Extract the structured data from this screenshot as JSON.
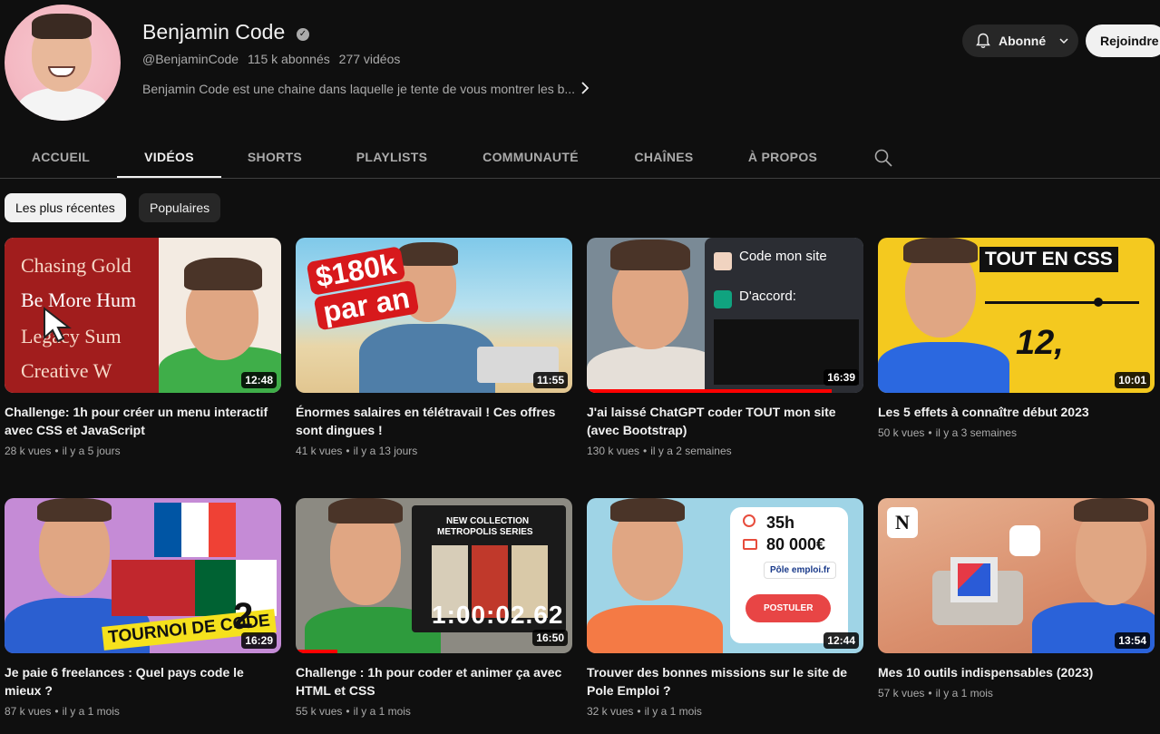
{
  "channel": {
    "name": "Benjamin Code",
    "handle": "@BenjaminCode",
    "subscribers": "115 k abonnés",
    "videos_count": "277 vidéos",
    "description": "Benjamin Code est une chaine dans laquelle je tente de vous montrer les b..."
  },
  "actions": {
    "subscribe_label": "Abonné",
    "join_label": "Rejoindre"
  },
  "tabs": [
    {
      "label": "ACCUEIL"
    },
    {
      "label": "VIDÉOS"
    },
    {
      "label": "SHORTS"
    },
    {
      "label": "PLAYLISTS"
    },
    {
      "label": "COMMUNAUTÉ"
    },
    {
      "label": "CHAÎNES"
    },
    {
      "label": "À PROPOS"
    }
  ],
  "chips": [
    {
      "label": "Les plus récentes"
    },
    {
      "label": "Populaires"
    }
  ],
  "videos": [
    {
      "title": "Challenge: 1h pour créer un menu interactif avec CSS et JavaScript",
      "views": "28 k vues",
      "age": "il y a 5 jours",
      "duration": "12:48",
      "thumb_lines": [
        "Chasing Gold",
        "Be More Hum",
        "Legacy Sum",
        "Creative W"
      ]
    },
    {
      "title": "Énormes salaires en télétravail ! Ces offres sont dingues !",
      "views": "41 k vues",
      "age": "il y a 13 jours",
      "duration": "11:55",
      "thumb_lines": [
        "$180k",
        "par an"
      ]
    },
    {
      "title": "J'ai laissé ChatGPT coder TOUT mon site (avec Bootstrap)",
      "views": "130 k vues",
      "age": "il y a 2 semaines",
      "duration": "16:39",
      "thumb_lines": [
        "Code mon site",
        "D'accord:"
      ]
    },
    {
      "title": "Les 5 effets à connaître début 2023",
      "views": "50 k vues",
      "age": "il y a 3 semaines",
      "duration": "10:01",
      "thumb_lines": [
        "TOUT EN CSS",
        "12,"
      ]
    },
    {
      "title": "Je paie 6 freelances : Quel pays code le mieux ?",
      "views": "87 k vues",
      "age": "il y a 1 mois",
      "duration": "16:29",
      "thumb_lines": [
        "TOURNOI DE CODE",
        "2"
      ]
    },
    {
      "title": "Challenge : 1h pour coder et animer ça avec HTML et CSS",
      "views": "55 k vues",
      "age": "il y a 1 mois",
      "duration": "16:50",
      "thumb_lines": [
        "NEW COLLECTION",
        "METROPOLIS SERIES",
        "1:00:02.62"
      ]
    },
    {
      "title": "Trouver des bonnes missions sur le site de Pole Emploi ?",
      "views": "32 k vues",
      "age": "il y a 1 mois",
      "duration": "12:44",
      "thumb_lines": [
        "35h",
        "80 000€",
        "Pôle emploi.fr",
        "POSTULER"
      ]
    },
    {
      "title": "Mes 10 outils indispensables (2023)",
      "views": "57 k vues",
      "age": "il y a 1 mois",
      "duration": "13:54",
      "thumb_lines": []
    }
  ]
}
